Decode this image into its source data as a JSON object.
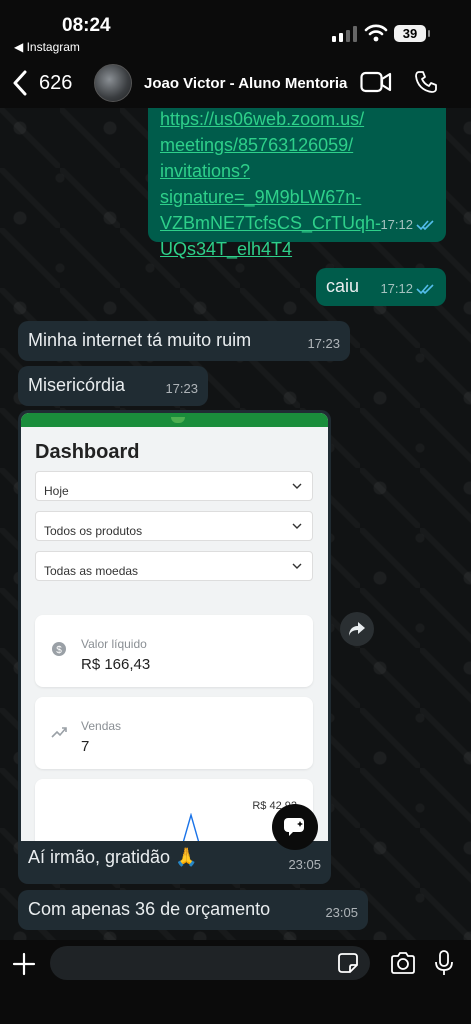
{
  "status_bar": {
    "time": "08:24",
    "back_app": "◀ Instagram",
    "battery": "39"
  },
  "header": {
    "unread_count": "626",
    "contact_name": "Joao Victor - Aluno Mentoria"
  },
  "messages": [
    {
      "type": "outgoing",
      "text": "https://us06web.zoom.us/\nmeetings/85763126059/\ninvitations?\nsignature=_9M9bLW67n-\nVZBmNE7TcfsCS_CrTUqh-\nUQs34T_elh4T4",
      "time": "17:12",
      "status": "read"
    },
    {
      "type": "outgoing",
      "text": "caiu",
      "time": "17:12",
      "status": "read"
    },
    {
      "type": "incoming",
      "text": "Minha internet tá muito ruim",
      "time": "17:23"
    },
    {
      "type": "incoming",
      "text": "Misericórdia",
      "time": "17:23"
    },
    {
      "type": "incoming",
      "text": "Aí irmão, gratidão 🙏",
      "time": "23:05"
    },
    {
      "type": "incoming",
      "text": "Com apenas 36 de orçamento",
      "time": "23:05"
    }
  ],
  "screenshot": {
    "title": "Dashboard",
    "filters": [
      "Hoje",
      "Todos os produtos",
      "Todas as moedas"
    ],
    "cards": [
      {
        "label": "Valor líquido",
        "value": "R$ 166,43",
        "icon": "dollar-coin-icon"
      },
      {
        "label": "Vendas",
        "value": "7",
        "icon": "trend-up-icon"
      }
    ],
    "chart_label": "R$ 42,92"
  },
  "input": {
    "placeholder": ""
  },
  "colors": {
    "outgoing_bubble": "#005c4b",
    "incoming_bubble": "#202c33",
    "read_ticks": "#53bdeb",
    "link": "#2ed08a"
  }
}
